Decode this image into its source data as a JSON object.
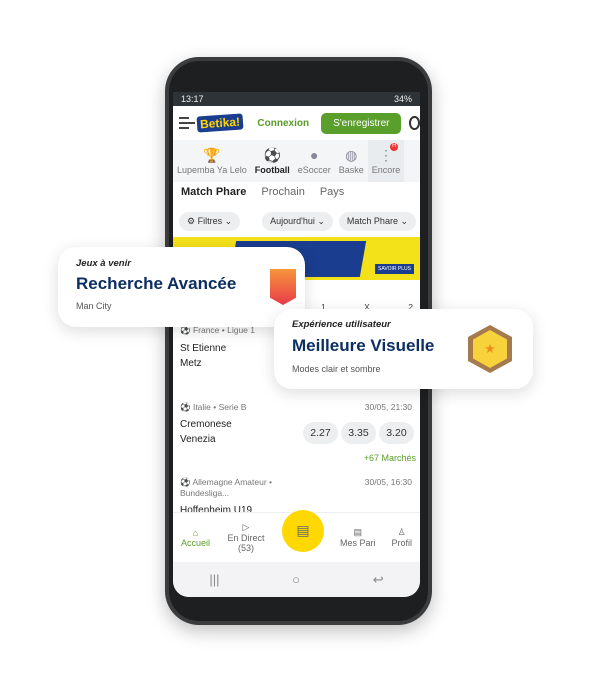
{
  "status": {
    "time": "13:17",
    "battery": "34%"
  },
  "header": {
    "logo": "Betika!",
    "login": "Connexion",
    "register": "S'enregistrer"
  },
  "sports": [
    {
      "icon": "trophy-icon",
      "label": "Lupemba Ya Lelo"
    },
    {
      "icon": "football-icon",
      "label": "Football"
    },
    {
      "icon": "esoccer-icon",
      "label": "eSoccer"
    },
    {
      "icon": "basketball-icon",
      "label": "Baske"
    },
    {
      "icon": "more-icon",
      "label": "Encore",
      "badge": "H"
    }
  ],
  "tabs": [
    "Match Phare",
    "Prochain",
    "Pays"
  ],
  "filters": [
    "Filtres",
    "Aujourd'hui",
    "Match Phare"
  ],
  "odds_header": [
    "1",
    "X",
    "2"
  ],
  "matches": [
    {
      "league": "France • Ligue 1",
      "home": "St Etienne",
      "away": "Metz"
    },
    {
      "league": "Italie • Serie B",
      "date": "30/05, 21:30",
      "home": "Cremonese",
      "away": "Venezia",
      "odds": [
        "2.27",
        "3.35",
        "3.20"
      ],
      "markets": "+67 Marchés"
    },
    {
      "league": "Allemagne Amateur • Bundesliga...",
      "date": "30/05, 16:30",
      "home": "Hoffenheim U19"
    }
  ],
  "bottom_nav": [
    {
      "label": "Accueil",
      "icon": "home-icon"
    },
    {
      "label": "En Direct (53)",
      "icon": "play-icon"
    },
    {
      "label": "",
      "icon": "betslip-icon"
    },
    {
      "label": "Mes Pari",
      "icon": "bets-icon"
    },
    {
      "label": "Profil",
      "icon": "user-icon"
    }
  ],
  "cards": [
    {
      "tag": "Jeux à venir",
      "title": "Recherche Avancée",
      "subtitle": "Man City"
    },
    {
      "tag": "Expérience utilisateur",
      "title": "Meilleure Visuelle",
      "subtitle": "Modes clair et sombre"
    }
  ],
  "colors": {
    "brand_green": "#5a9e2c",
    "nav_yellow": "#ffd800",
    "title_blue": "#0d2e62"
  }
}
